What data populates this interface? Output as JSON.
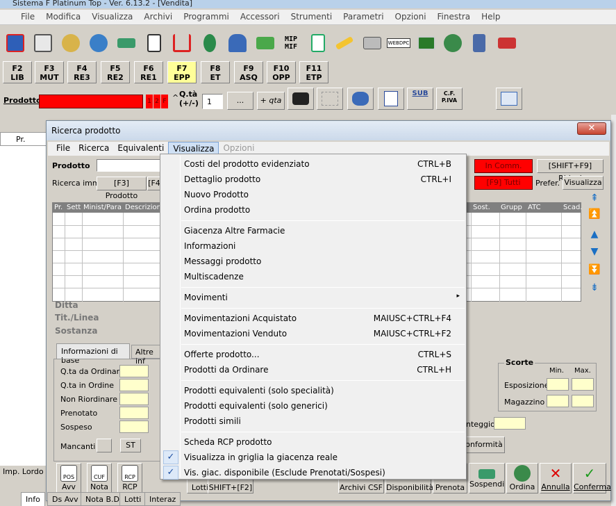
{
  "window_title": "Sistema F Platinum Top - Ver. 6.13.2 - [Vendita]",
  "main_menu": [
    "File",
    "Modifica",
    "Visualizza",
    "Archivi",
    "Programmi",
    "Accessori",
    "Strumenti",
    "Parametri",
    "Opzioni",
    "Finestra",
    "Help"
  ],
  "toolbar_text_icons": {
    "mif": "MIP\nMIF",
    "webdpc": "WEBDPC",
    "sub": "SUB",
    "cf": "C.F.\nP.IVA"
  },
  "fkeys": [
    {
      "key": "F2",
      "label": "LIB"
    },
    {
      "key": "F3",
      "label": "MUT"
    },
    {
      "key": "F4",
      "label": "RE3"
    },
    {
      "key": "F5",
      "label": "RE2"
    },
    {
      "key": "F6",
      "label": "RE1"
    },
    {
      "key": "F7",
      "label": "EPP"
    },
    {
      "key": "F8",
      "label": "ET"
    },
    {
      "key": "F9",
      "label": "ASQ"
    },
    {
      "key": "F10",
      "label": "OPP"
    },
    {
      "key": "F11",
      "label": "ETP"
    }
  ],
  "product_row": {
    "label": "Prodotto",
    "mini_buttons": [
      "1",
      "2",
      "F"
    ],
    "caret": "^",
    "qty_label": "Q.tà\n(+/-)",
    "qty_value": "1",
    "dots_button": "...",
    "plus_qty_button": "+ qta"
  },
  "bg_grid": {
    "col1": "Pr."
  },
  "dialog": {
    "title": "Ricerca prodotto",
    "close": "✕",
    "menu": [
      "File",
      "Ricerca",
      "Equivalenti",
      "Visualizza",
      "Opzioni"
    ],
    "prodotto_label": "Prodotto",
    "ricerca_imm_label": "Ricerca imm.",
    "f3_button": "[F3] Prodotto",
    "f4_button": "[F4",
    "in_comm": "In Comm.",
    "f9_tutti": "[F9] Tutti",
    "riduci_button": "[SHIFT+F9] Riduci",
    "prefer_label": "Prefer.",
    "visualizza_button": "Visualizza",
    "grid_headers": [
      "Pr.",
      "Sett",
      "Minist/Para",
      "Descrizione",
      "Sost.",
      "Grupp",
      "ATC",
      "Scad."
    ],
    "ditta": "Ditta",
    "tit_linea": "Tit./Linea",
    "sostanza": "Sostanza",
    "tabs": [
      "Informazioni di base",
      "Altre inf"
    ],
    "fields": [
      "Q.ta da Ordinare",
      "Q.ta in Ordine",
      "Non Riordinare",
      "Prenotato",
      "Sospeso"
    ],
    "mancanti": "Mancanti",
    "st_button": "ST",
    "scorte_title": "Scorte",
    "scorte_cols": [
      "Min.",
      "Max."
    ],
    "scorte_rows": [
      "Esposizione",
      "Magazzino"
    ],
    "punteggio": "nteggio",
    "conformita": "onformità",
    "bottom_buttons": [
      {
        "icon": "POS",
        "label": "Avv"
      },
      {
        "icon": "CUF",
        "label": "Nota"
      },
      {
        "icon": "RCP",
        "label": "RCP"
      },
      {
        "icon": "",
        "label": "Lotti"
      },
      {
        "icon": "",
        "label": "SHIFT+[F2]"
      },
      {
        "icon": "",
        "label": "Archivi CSF"
      },
      {
        "icon": "",
        "label": "Disponibilità"
      },
      {
        "icon": "",
        "label": "Prenota"
      },
      {
        "icon": "",
        "label": "Sospendi"
      },
      {
        "icon": "",
        "label": "Ordina"
      },
      {
        "icon": "",
        "label": "Annulla"
      },
      {
        "icon": "",
        "label": "Conferma"
      }
    ]
  },
  "dropdown": {
    "items": [
      {
        "label": "Costi del prodotto evidenziato",
        "shortcut": "CTRL+B"
      },
      {
        "label": "Dettaglio prodotto",
        "shortcut": "CTRL+I"
      },
      {
        "label": "Nuovo Prodotto",
        "shortcut": ""
      },
      {
        "label": "Ordina prodotto",
        "shortcut": ""
      },
      {
        "label": "Giacenza Altre Farmacie",
        "shortcut": ""
      },
      {
        "label": "Informazioni",
        "shortcut": ""
      },
      {
        "label": "Messaggi prodotto",
        "shortcut": ""
      },
      {
        "label": "Multiscadenze",
        "shortcut": ""
      },
      {
        "label": "Movimenti",
        "shortcut": "▸"
      },
      {
        "label": "Movimentazioni Acquistato",
        "shortcut": "MAIUSC+CTRL+F4"
      },
      {
        "label": "Movimentazioni Venduto",
        "shortcut": "MAIUSC+CTRL+F2"
      },
      {
        "label": "Offerte prodotto...",
        "shortcut": "CTRL+S"
      },
      {
        "label": "Prodotti da Ordinare",
        "shortcut": "CTRL+H"
      },
      {
        "label": "Prodotti equivalenti (solo specialità)",
        "shortcut": ""
      },
      {
        "label": "Prodotti equivalenti (solo generici)",
        "shortcut": ""
      },
      {
        "label": "Prodotti simili",
        "shortcut": ""
      },
      {
        "label": "Scheda RCP prodotto",
        "shortcut": ""
      },
      {
        "label": "Visualizza in griglia la giacenza reale",
        "shortcut": "",
        "checked": true
      },
      {
        "label": "Vis. giac. disponibile (Esclude Prenotati/Sospesi)",
        "shortcut": "",
        "checked": true
      }
    ]
  },
  "left_panel": {
    "imp_lordo": "Imp. Lordo"
  },
  "status_tabs": [
    "Info",
    "Ds Avv",
    "Nota B.D",
    "Lotti",
    "Interaz"
  ]
}
